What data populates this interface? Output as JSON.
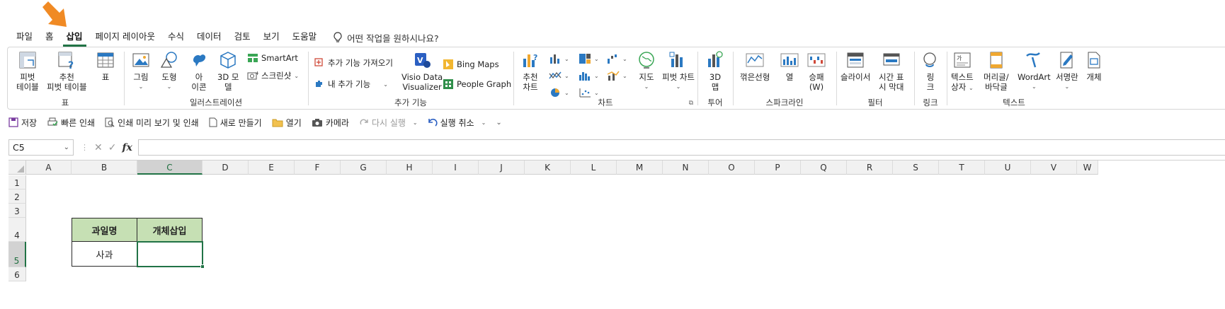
{
  "menu": {
    "tabs": [
      "파일",
      "홈",
      "삽입",
      "페이지 레이아웃",
      "수식",
      "데이터",
      "검토",
      "보기",
      "도움말"
    ],
    "active_index": 2,
    "tell_me": "어떤 작업을 원하시나요?"
  },
  "ribbon": {
    "groups": {
      "tables": {
        "label": "표",
        "pivot": [
          "피벗",
          "테이블"
        ],
        "recommended_pivot": [
          "추천",
          "피벗 테이블"
        ],
        "table": "표"
      },
      "illustrations": {
        "label": "일러스트레이션",
        "pictures": "그림",
        "shapes": "도형",
        "icons": [
          "아",
          "이콘"
        ],
        "model3d": [
          "3D 모",
          "델"
        ],
        "smartart": "SmartArt",
        "screenshot": "스크린샷"
      },
      "addins": {
        "label": "추가 기능",
        "get_addins": "추가 기능 가져오기",
        "my_addins": "내 추가 기능",
        "visio": [
          "Visio Data",
          "Visualizer"
        ],
        "bing_maps": "Bing Maps",
        "people_graph": "People Graph"
      },
      "charts": {
        "label": "차트",
        "recommended": [
          "추천",
          "차트"
        ],
        "map": "지도",
        "pivot_chart": "피벗 차트"
      },
      "tours": {
        "label": "투어",
        "map3d": [
          "3D",
          "맵"
        ]
      },
      "sparklines": {
        "label": "스파크라인",
        "line": "꺾은선형",
        "column": "열",
        "winloss": [
          "승패",
          "(W)"
        ]
      },
      "filters": {
        "label": "필터",
        "slicer": "슬라이서",
        "timeline": [
          "시간 표",
          "시 막대"
        ]
      },
      "links": {
        "label": "링크",
        "link": [
          "링",
          "크"
        ]
      },
      "text": {
        "label": "텍스트",
        "textbox": [
          "텍스트",
          "상자"
        ],
        "header_footer": [
          "머리글/",
          "바닥글"
        ],
        "wordart": "WordArt",
        "signature": "서명란",
        "object": "개체"
      }
    }
  },
  "qat": {
    "save": "저장",
    "quick_print": "빠른 인쇄",
    "print_preview": "인쇄 미리 보기 및 인쇄",
    "new": "새로 만들기",
    "open": "열기",
    "camera": "카메라",
    "redo": "다시 실행",
    "undo": "실행 취소"
  },
  "formula_bar": {
    "name_box": "C5",
    "fx": "fx",
    "value": ""
  },
  "grid": {
    "columns": [
      "A",
      "B",
      "C",
      "D",
      "E",
      "F",
      "G",
      "H",
      "I",
      "J",
      "K",
      "L",
      "M",
      "N",
      "O",
      "P",
      "Q",
      "R",
      "S",
      "T",
      "U",
      "V",
      "W"
    ],
    "rows": [
      "1",
      "2",
      "3",
      "4",
      "5",
      "6"
    ],
    "selected_column": "C",
    "selected_row": "5",
    "cells": {
      "B4": "과일명",
      "C4": "개체삽입",
      "B5": "사과",
      "C5": ""
    }
  },
  "colors": {
    "accent": "#217346",
    "header_fill": "#c6e0b4",
    "arrow": "#f08a24"
  }
}
